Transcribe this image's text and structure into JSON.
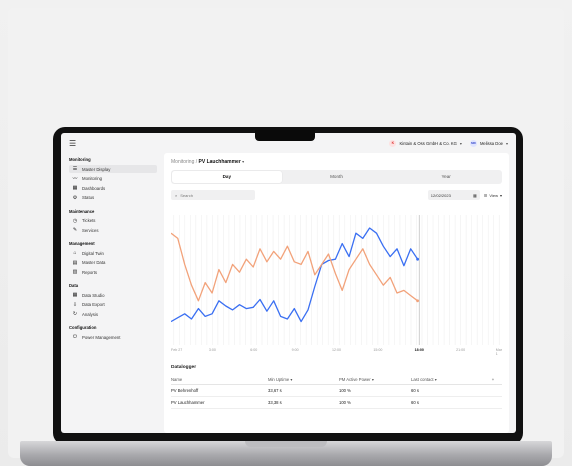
{
  "header": {
    "menu_icon": "hamburger-icon",
    "company": "Kintain & Oss GmbH & Co. KG",
    "company_initial": "K",
    "user": "Melissa Doe",
    "user_initials": "MD"
  },
  "sidebar": {
    "sections": [
      {
        "title": "Monitoring",
        "items": [
          {
            "label": "Master Display",
            "icon": "list-icon",
            "active": true
          },
          {
            "label": "Monitoring",
            "icon": "trend-icon"
          },
          {
            "label": "Dashboards",
            "icon": "dashboard-icon"
          },
          {
            "label": "Status",
            "icon": "gear-icon"
          }
        ]
      },
      {
        "title": "Maintenance",
        "items": [
          {
            "label": "Tickets",
            "icon": "clock-icon"
          },
          {
            "label": "Services",
            "icon": "wrench-icon"
          }
        ]
      },
      {
        "title": "Management",
        "items": [
          {
            "label": "Digital Twin",
            "icon": "building-icon"
          },
          {
            "label": "Master Data",
            "icon": "document-icon"
          },
          {
            "label": "Reports",
            "icon": "report-icon"
          }
        ]
      },
      {
        "title": "Data",
        "items": [
          {
            "label": "Data Studio",
            "icon": "table-icon"
          },
          {
            "label": "Data Export",
            "icon": "download-icon"
          },
          {
            "label": "Analysis",
            "icon": "refresh-icon"
          }
        ]
      },
      {
        "title": "Configuration",
        "items": [
          {
            "label": "Power Management",
            "icon": "power-icon"
          }
        ]
      }
    ]
  },
  "main": {
    "breadcrumb": {
      "parent": "Monitoring",
      "current": "PV Lauchhammer"
    },
    "tabs": [
      "Day",
      "Month",
      "Year"
    ],
    "active_tab": "Day",
    "search_placeholder": "Search",
    "date": "12/02/2023",
    "view_label": "View"
  },
  "chart_data": {
    "type": "line",
    "x": [
      "Feb 27",
      "3:00",
      "6:00",
      "9:00",
      "12:00",
      "15:00",
      "18:00",
      "21:00",
      "Mar 1"
    ],
    "highlight_tick": "18:00",
    "series": [
      {
        "color": "#3a6ff2",
        "values": [
          0.18,
          0.21,
          0.24,
          0.2,
          0.28,
          0.22,
          0.24,
          0.34,
          0.3,
          0.27,
          0.31,
          0.28,
          0.29,
          0.35,
          0.26,
          0.34,
          0.22,
          0.2,
          0.28,
          0.18,
          0.27,
          0.45,
          0.62,
          0.65,
          0.66,
          0.78,
          0.68,
          0.86,
          0.82,
          0.9,
          0.86,
          0.76,
          0.68,
          0.74,
          0.61,
          0.74,
          0.66
        ]
      },
      {
        "color": "#f2a27a",
        "values": [
          0.86,
          0.82,
          0.62,
          0.46,
          0.34,
          0.48,
          0.4,
          0.58,
          0.48,
          0.62,
          0.56,
          0.66,
          0.6,
          0.74,
          0.64,
          0.72,
          0.66,
          0.76,
          0.64,
          0.62,
          0.72,
          0.54,
          0.62,
          0.7,
          0.55,
          0.42,
          0.58,
          0.66,
          0.74,
          0.62,
          0.54,
          0.46,
          0.52,
          0.4,
          0.42,
          0.38,
          0.34
        ]
      }
    ],
    "ylim": [
      0,
      1
    ],
    "grid": true
  },
  "table": {
    "title": "Datalogger",
    "columns": [
      "Name",
      "Min Uptime",
      "PM Active Power",
      "Last contact",
      "+"
    ],
    "rows": [
      [
        "PV Behrenhoff",
        "33,67 s",
        "100 %",
        "60 s"
      ],
      [
        "PV Lauchhammer",
        "33,38 s",
        "100 %",
        "60 s"
      ]
    ]
  }
}
